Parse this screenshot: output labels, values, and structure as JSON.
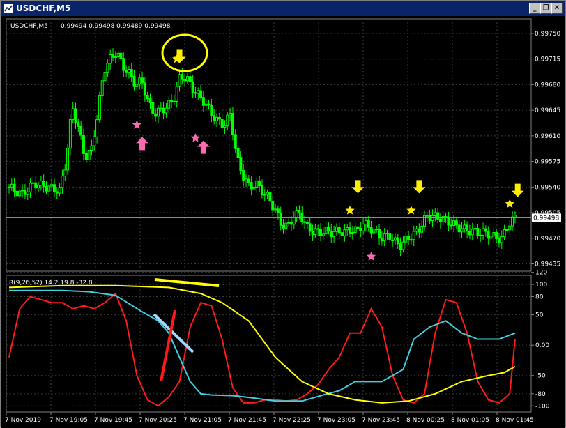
{
  "window": {
    "title": "USDCHF,M5",
    "buttons": [
      "minimize",
      "restore",
      "close"
    ]
  },
  "colors": {
    "background": "#000000",
    "grid": "#3a3a3a",
    "bull": "#00ff00",
    "bear": "#ffffff",
    "red_line": "#ff1a1a",
    "cyan_line": "#40d0e0",
    "yellow_line": "#ffff00",
    "star_yellow": "#ffee00",
    "star_pink": "#ff69b4"
  },
  "chart_data": [
    {
      "type": "candlestick",
      "title": "USDCHF,M5",
      "ohlc_header": "0.99494 0.99498 0.99489 0.99498",
      "price_ticks": [
        "0.99750",
        "0.99715",
        "0.99680",
        "0.99645",
        "0.99610",
        "0.99575",
        "0.99540",
        "0.99505",
        "0.99470",
        "0.99435"
      ],
      "current_price": "0.99498",
      "ylim": [
        0.99425,
        0.9977
      ],
      "time_labels": [
        "7 Nov 2019",
        "7 Nov 19:05",
        "7 Nov 19:45",
        "7 Nov 20:25",
        "7 Nov 21:05",
        "7 Nov 21:45",
        "7 Nov 22:25",
        "7 Nov 23:05",
        "7 Nov 23:45",
        "8 Nov 00:25",
        "8 Nov 01:05",
        "8 Nov 01:45"
      ],
      "close_path": [
        [
          0,
          0.9954
        ],
        [
          4,
          0.9953
        ],
        [
          8,
          0.99545
        ],
        [
          12,
          0.9954
        ],
        [
          16,
          0.99535
        ],
        [
          18,
          0.99575
        ],
        [
          20,
          0.9965
        ],
        [
          22,
          0.9962
        ],
        [
          24,
          0.9958
        ],
        [
          26,
          0.9959
        ],
        [
          28,
          0.9964
        ],
        [
          30,
          0.997
        ],
        [
          32,
          0.99715
        ],
        [
          34,
          0.99725
        ],
        [
          36,
          0.99705
        ],
        [
          38,
          0.99695
        ],
        [
          40,
          0.9968
        ],
        [
          42,
          0.99685
        ],
        [
          44,
          0.99655
        ],
        [
          46,
          0.9964
        ],
        [
          48,
          0.99645
        ],
        [
          50,
          0.9965
        ],
        [
          52,
          0.9966
        ],
        [
          54,
          0.9969
        ],
        [
          56,
          0.9969
        ],
        [
          58,
          0.99675
        ],
        [
          60,
          0.99665
        ],
        [
          62,
          0.99655
        ],
        [
          64,
          0.9964
        ],
        [
          66,
          0.9963
        ],
        [
          68,
          0.99625
        ],
        [
          70,
          0.9964
        ],
        [
          72,
          0.9958
        ],
        [
          74,
          0.99555
        ],
        [
          76,
          0.9954
        ],
        [
          78,
          0.99545
        ],
        [
          80,
          0.99535
        ],
        [
          82,
          0.99525
        ],
        [
          84,
          0.9951
        ],
        [
          86,
          0.9949
        ],
        [
          88,
          0.99485
        ],
        [
          90,
          0.995
        ],
        [
          92,
          0.99505
        ],
        [
          94,
          0.99485
        ],
        [
          96,
          0.9948
        ],
        [
          98,
          0.99478
        ],
        [
          100,
          0.9948
        ],
        [
          102,
          0.99478
        ],
        [
          104,
          0.9948
        ],
        [
          106,
          0.99478
        ],
        [
          108,
          0.99482
        ],
        [
          110,
          0.9948
        ],
        [
          112,
          0.9949
        ],
        [
          114,
          0.99485
        ],
        [
          116,
          0.99478
        ],
        [
          118,
          0.9947
        ],
        [
          120,
          0.99475
        ],
        [
          122,
          0.99465
        ],
        [
          124,
          0.9946
        ],
        [
          126,
          0.9947
        ],
        [
          128,
          0.99475
        ],
        [
          130,
          0.99485
        ],
        [
          132,
          0.995
        ],
        [
          134,
          0.995
        ],
        [
          136,
          0.99498
        ],
        [
          138,
          0.99495
        ],
        [
          140,
          0.9949
        ],
        [
          142,
          0.99485
        ],
        [
          144,
          0.99482
        ],
        [
          146,
          0.9948
        ],
        [
          148,
          0.99478
        ],
        [
          150,
          0.99478
        ],
        [
          152,
          0.99475
        ],
        [
          154,
          0.9947
        ],
        [
          156,
          0.9947
        ],
        [
          158,
          0.9949
        ],
        [
          160,
          0.99498
        ]
      ],
      "markers": [
        {
          "type": "yellow_star",
          "bar": 63,
          "price": 0.99715
        },
        {
          "type": "yellow_down_arrow",
          "bar": 64,
          "price": 0.99718
        },
        {
          "type": "pink_star",
          "bar": 48,
          "price": 0.99625
        },
        {
          "type": "pink_up_arrow",
          "bar": 50,
          "price": 0.996
        },
        {
          "type": "pink_star",
          "bar": 70,
          "price": 0.99607
        },
        {
          "type": "pink_up_arrow",
          "bar": 73,
          "price": 0.99595
        },
        {
          "type": "yellow_star",
          "bar": 128,
          "price": 0.99508
        },
        {
          "type": "yellow_down_arrow",
          "bar": 131,
          "price": 0.9954
        },
        {
          "type": "pink_star",
          "bar": 136,
          "price": 0.99445
        },
        {
          "type": "yellow_star",
          "bar": 151,
          "price": 0.99508
        },
        {
          "type": "yellow_down_arrow",
          "bar": 154,
          "price": 0.9954
        },
        {
          "type": "yellow_star",
          "bar": 188,
          "price": 0.99517
        },
        {
          "type": "yellow_down_arrow",
          "bar": 191,
          "price": 0.99535
        }
      ]
    },
    {
      "type": "line",
      "title": "R(9,26,52) 14.2 19.8 -32.8",
      "ylim": [
        -110,
        115
      ],
      "y_ticks": [
        "120",
        "100",
        "80",
        "50",
        "0.00",
        "-50",
        "-80",
        "-100"
      ],
      "series": [
        {
          "color": "#ff1a1a",
          "values": [
            [
              0,
              -20
            ],
            [
              4,
              60
            ],
            [
              8,
              80
            ],
            [
              12,
              75
            ],
            [
              16,
              70
            ],
            [
              20,
              70
            ],
            [
              24,
              60
            ],
            [
              28,
              65
            ],
            [
              32,
              60
            ],
            [
              36,
              70
            ],
            [
              40,
              85
            ],
            [
              44,
              40
            ],
            [
              48,
              -50
            ],
            [
              52,
              -90
            ],
            [
              56,
              -100
            ],
            [
              60,
              -85
            ],
            [
              64,
              -60
            ],
            [
              68,
              30
            ],
            [
              72,
              70
            ],
            [
              76,
              65
            ],
            [
              80,
              10
            ],
            [
              84,
              -70
            ],
            [
              88,
              -95
            ],
            [
              92,
              -95
            ],
            [
              96,
              -90
            ],
            [
              100,
              -90
            ],
            [
              104,
              -92
            ],
            [
              108,
              -90
            ],
            [
              112,
              -80
            ],
            [
              116,
              -65
            ],
            [
              120,
              -40
            ],
            [
              124,
              -20
            ],
            [
              128,
              20
            ],
            [
              132,
              20
            ],
            [
              136,
              60
            ],
            [
              140,
              30
            ],
            [
              144,
              -50
            ],
            [
              148,
              -90
            ],
            [
              152,
              -95
            ],
            [
              156,
              -80
            ],
            [
              160,
              20
            ],
            [
              164,
              75
            ],
            [
              168,
              70
            ],
            [
              172,
              20
            ],
            [
              176,
              -60
            ],
            [
              180,
              -90
            ],
            [
              184,
              -95
            ],
            [
              188,
              -80
            ],
            [
              190,
              10
            ]
          ]
        },
        {
          "color": "#40d0e0",
          "values": [
            [
              0,
              90
            ],
            [
              10,
              90
            ],
            [
              20,
              90
            ],
            [
              30,
              88
            ],
            [
              40,
              82
            ],
            [
              50,
              55
            ],
            [
              56,
              40
            ],
            [
              60,
              20
            ],
            [
              64,
              -20
            ],
            [
              68,
              -60
            ],
            [
              72,
              -80
            ],
            [
              76,
              -82
            ],
            [
              84,
              -83
            ],
            [
              92,
              -87
            ],
            [
              100,
              -92
            ],
            [
              110,
              -92
            ],
            [
              118,
              -82
            ],
            [
              124,
              -75
            ],
            [
              130,
              -60
            ],
            [
              140,
              -60
            ],
            [
              148,
              -40
            ],
            [
              152,
              10
            ],
            [
              158,
              30
            ],
            [
              164,
              40
            ],
            [
              170,
              20
            ],
            [
              176,
              10
            ],
            [
              184,
              10
            ],
            [
              190,
              20
            ]
          ]
        },
        {
          "color": "#ffff00",
          "values": [
            [
              0,
              95
            ],
            [
              20,
              98
            ],
            [
              40,
              98
            ],
            [
              60,
              95
            ],
            [
              72,
              85
            ],
            [
              80,
              70
            ],
            [
              90,
              40
            ],
            [
              100,
              -20
            ],
            [
              110,
              -60
            ],
            [
              120,
              -80
            ],
            [
              130,
              -90
            ],
            [
              140,
              -95
            ],
            [
              150,
              -92
            ],
            [
              160,
              -80
            ],
            [
              170,
              -60
            ],
            [
              180,
              -50
            ],
            [
              186,
              -45
            ],
            [
              190,
              -35
            ]
          ]
        }
      ],
      "annotations": [
        "yellow_line_stroke",
        "light_blue_line_stroke",
        "red_line_stroke"
      ]
    }
  ]
}
